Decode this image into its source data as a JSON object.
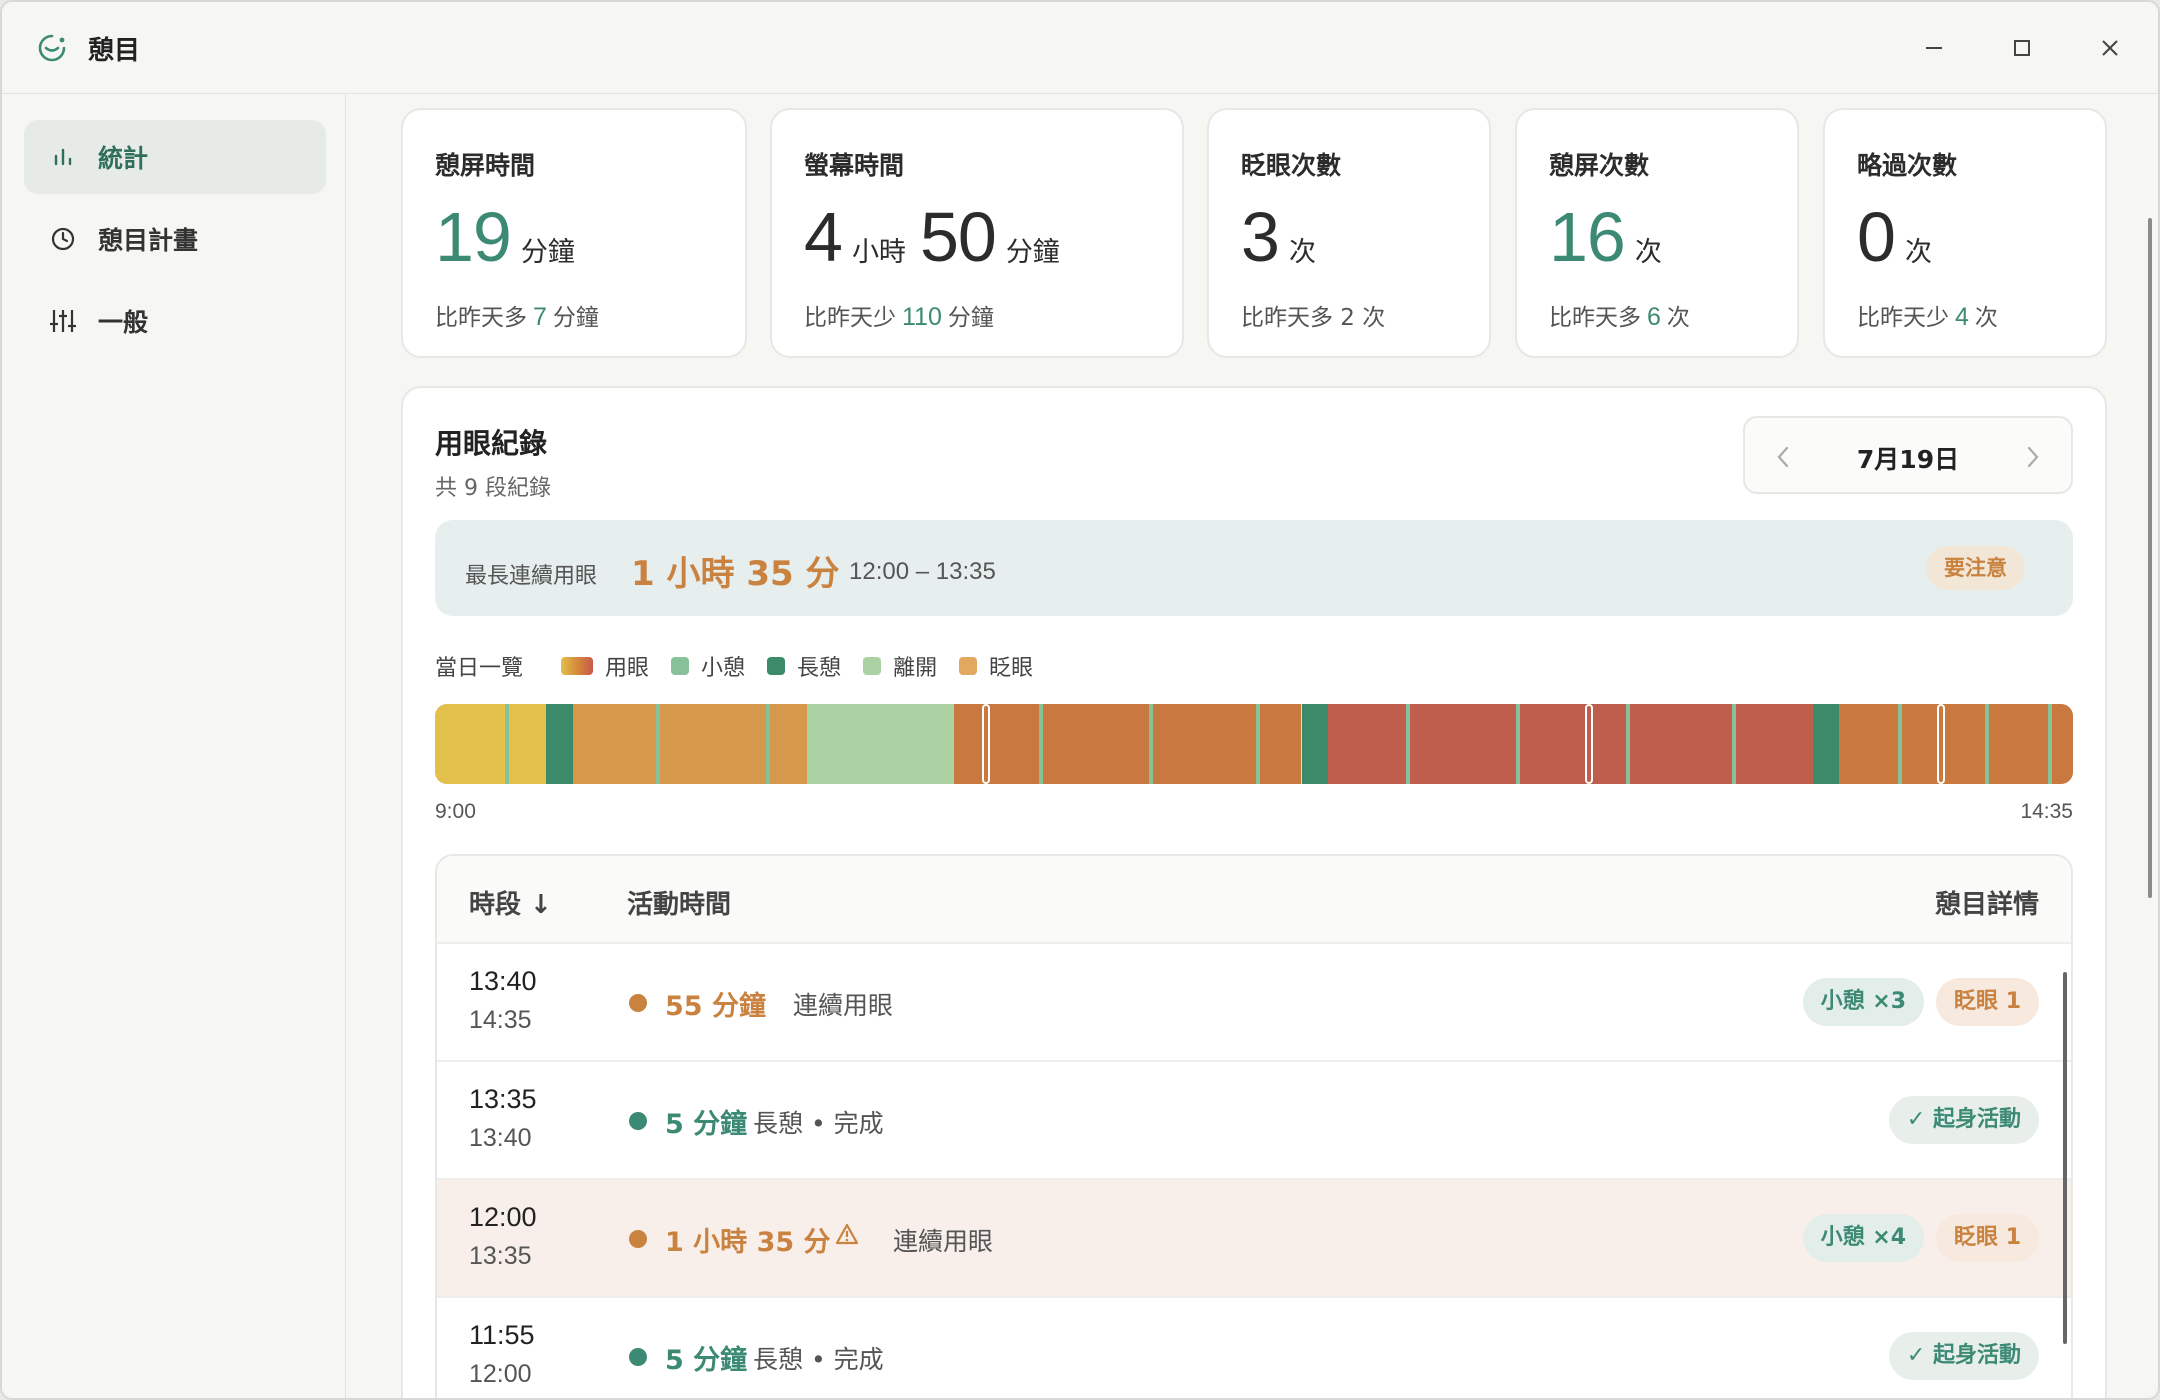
{
  "app": {
    "title": "憩目"
  },
  "sidebar": {
    "items": [
      {
        "label": "統計",
        "icon": "bar-chart-icon",
        "active": true
      },
      {
        "label": "憩目計畫",
        "icon": "clock-icon",
        "active": false
      },
      {
        "label": "一般",
        "icon": "sliders-icon",
        "active": false
      }
    ]
  },
  "stats": {
    "rest_time": {
      "title": "憩屏時間",
      "value": "19",
      "unit": "分鐘",
      "compare_prefix": "比昨天多",
      "compare_value": "7",
      "compare_unit": "分鐘"
    },
    "screen_time": {
      "title": "螢幕時間",
      "hours": "4",
      "hours_unit": "小時",
      "minutes": "50",
      "minutes_unit": "分鐘",
      "compare_prefix": "比昨天少",
      "compare_value": "110",
      "compare_unit": "分鐘"
    },
    "blinks": {
      "title": "眨眼次數",
      "value": "3",
      "unit": "次",
      "compare": "比昨天多 2 次"
    },
    "rest_count": {
      "title": "憩屏次數",
      "value": "16",
      "unit": "次",
      "compare_prefix": "比昨天多",
      "compare_value": "6",
      "compare_unit": "次"
    },
    "skip_count": {
      "title": "略過次數",
      "value": "0",
      "unit": "次",
      "compare_prefix": "比昨天少",
      "compare_value": "4",
      "compare_unit": "次"
    }
  },
  "record": {
    "title": "用眼紀錄",
    "subtitle": "共 9 段紀錄",
    "date": "7月19日",
    "longest_label": "最長連續用眼",
    "longest_value": "1 小時 35 分",
    "longest_range": "12:00 – 13:35",
    "warn_badge": "要注意",
    "legend_title": "當日一覽",
    "legend": [
      {
        "label": "用眼",
        "color": "gradient"
      },
      {
        "label": "小憩",
        "color": "#86c19a"
      },
      {
        "label": "長憩",
        "color": "#3d8a6a"
      },
      {
        "label": "離開",
        "color": "#acd1a3"
      },
      {
        "label": "眨眼",
        "color": "#e2a860"
      }
    ],
    "time_start": "9:00",
    "time_end": "14:35"
  },
  "table": {
    "headers": {
      "period": "時段 ↓",
      "activity": "活動時間",
      "detail": "憩目詳情"
    },
    "rows": [
      {
        "start": "13:40",
        "end": "14:35",
        "duration": "55 分鐘",
        "desc": "連續用眼",
        "kind": "use",
        "badges": [
          {
            "text": "小憩 ×3",
            "style": "green"
          },
          {
            "text": "眨眼 1",
            "style": "orange"
          }
        ]
      },
      {
        "start": "13:35",
        "end": "13:40",
        "duration": "5 分鐘",
        "desc": "長憩 • 完成",
        "kind": "rest",
        "badges": [
          {
            "text": "✓ 起身活動",
            "style": "check"
          }
        ]
      },
      {
        "start": "12:00",
        "end": "13:35",
        "duration": "1 小時 35 分",
        "desc": "連續用眼",
        "kind": "warn",
        "badges": [
          {
            "text": "小憩 ×4",
            "style": "green"
          },
          {
            "text": "眨眼 1",
            "style": "orange"
          }
        ]
      },
      {
        "start": "11:55",
        "end": "12:00",
        "duration": "5 分鐘",
        "desc": "長憩 • 完成",
        "kind": "rest",
        "badges": [
          {
            "text": "✓ 起身活動",
            "style": "check"
          }
        ]
      }
    ]
  },
  "colors": {
    "accent": "#3d8a74",
    "warn": "#c9823f",
    "use_yellow": "#e3bf4b",
    "use_orange": "#d58a3a",
    "use_red": "#c8594a",
    "long_rest": "#3d8a6a",
    "away": "#acd1a3"
  }
}
